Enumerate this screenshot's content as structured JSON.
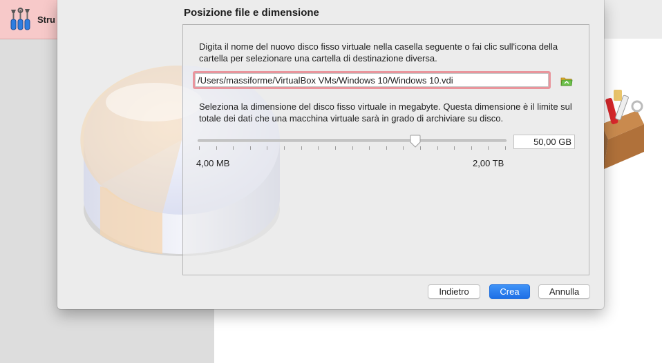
{
  "background_app": {
    "tools_label": "Stru",
    "tools_icon": "tools-icon",
    "toolbox_icon": "toolbox-icon"
  },
  "dialog": {
    "title": "Posizione file e dimensione",
    "location_description": "Digita il nome del nuovo disco fisso virtuale nella casella seguente o fai clic sull'icona della cartella per selezionare una cartella di destinazione diversa.",
    "file_path": "/Users/massiforme/VirtualBox VMs/Windows 10/Windows 10.vdi",
    "folder_icon": "folder-icon",
    "size_description": "Seleziona la dimensione del disco fisso virtuale in megabyte. Questa dimensione è il limite sul totale dei dati che una macchina virtuale sarà in grado di archiviare su disco.",
    "size": {
      "value": "50,00 GB",
      "min_label": "4,00 MB",
      "max_label": "2,00 TB",
      "slider_fraction": 0.705
    },
    "disk_art": "hard-disk-illustration",
    "buttons": {
      "back": "Indietro",
      "create": "Crea",
      "cancel": "Annulla"
    }
  },
  "colors": {
    "accent": "#1e6fe6",
    "focus_ring": "#e87882",
    "background_highlight": "#f7c9c9"
  }
}
